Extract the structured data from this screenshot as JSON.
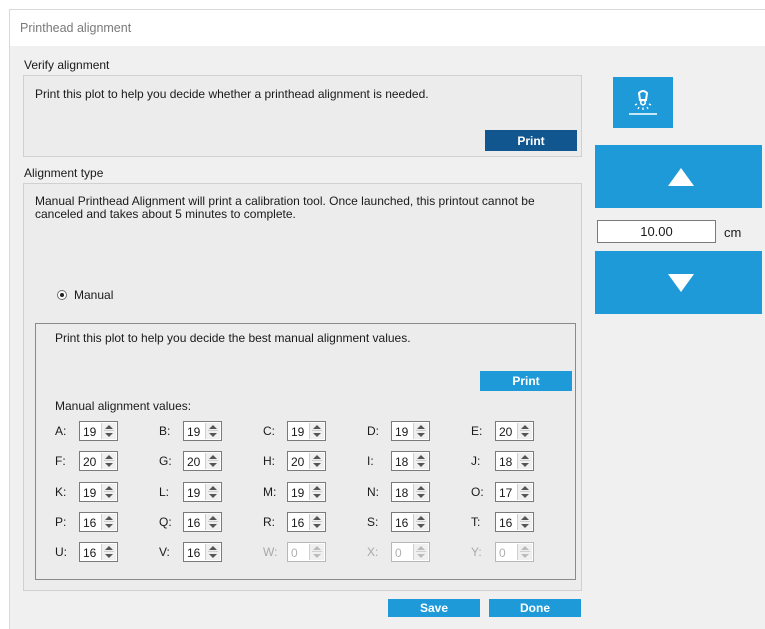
{
  "window": {
    "title": "Printhead alignment"
  },
  "verify": {
    "group_label": "Verify alignment",
    "description": "Print this plot to help you decide whether a printhead alignment is needed.",
    "print_label": "Print"
  },
  "alignment": {
    "group_label": "Alignment type",
    "description_line1": "Manual Printhead Alignment will print a calibration tool. Once launched, this printout cannot be",
    "description_line2": "canceled and takes about 5 minutes to complete.",
    "radio_label": "Manual",
    "radio_selected": true
  },
  "manual": {
    "description": "Print this plot to help you decide the best manual alignment values.",
    "print_label": "Print",
    "values_label": "Manual alignment values:",
    "rows": [
      [
        {
          "label": "A:",
          "value": "19",
          "enabled": true
        },
        {
          "label": "B:",
          "value": "19",
          "enabled": true
        },
        {
          "label": "C:",
          "value": "19",
          "enabled": true
        },
        {
          "label": "D:",
          "value": "19",
          "enabled": true
        },
        {
          "label": "E:",
          "value": "20",
          "enabled": true
        }
      ],
      [
        {
          "label": "F:",
          "value": "20",
          "enabled": true
        },
        {
          "label": "G:",
          "value": "20",
          "enabled": true
        },
        {
          "label": "H:",
          "value": "20",
          "enabled": true
        },
        {
          "label": "I:",
          "value": "18",
          "enabled": true
        },
        {
          "label": "J:",
          "value": "18",
          "enabled": true
        }
      ],
      [
        {
          "label": "K:",
          "value": "19",
          "enabled": true
        },
        {
          "label": "L:",
          "value": "19",
          "enabled": true
        },
        {
          "label": "M:",
          "value": "19",
          "enabled": true
        },
        {
          "label": "N:",
          "value": "18",
          "enabled": true
        },
        {
          "label": "O:",
          "value": "17",
          "enabled": true
        }
      ],
      [
        {
          "label": "P:",
          "value": "16",
          "enabled": true
        },
        {
          "label": "Q:",
          "value": "16",
          "enabled": true
        },
        {
          "label": "R:",
          "value": "16",
          "enabled": true
        },
        {
          "label": "S:",
          "value": "16",
          "enabled": true
        },
        {
          "label": "T:",
          "value": "16",
          "enabled": true
        }
      ],
      [
        {
          "label": "U:",
          "value": "16",
          "enabled": true
        },
        {
          "label": "V:",
          "value": "16",
          "enabled": true
        },
        {
          "label": "W:",
          "value": "0",
          "enabled": false
        },
        {
          "label": "X:",
          "value": "0",
          "enabled": false
        },
        {
          "label": "Y:",
          "value": "0",
          "enabled": false
        }
      ]
    ]
  },
  "footer": {
    "save_label": "Save",
    "done_label": "Done"
  },
  "side": {
    "distance_value": "10.00",
    "unit": "cm",
    "light_icon": "light-bulb-icon",
    "up_icon": "arrow-up-icon",
    "down_icon": "arrow-down-icon"
  },
  "colors": {
    "accent": "#1f9ad9",
    "accent_dark": "#12568f",
    "background": "#f0f0f0"
  }
}
